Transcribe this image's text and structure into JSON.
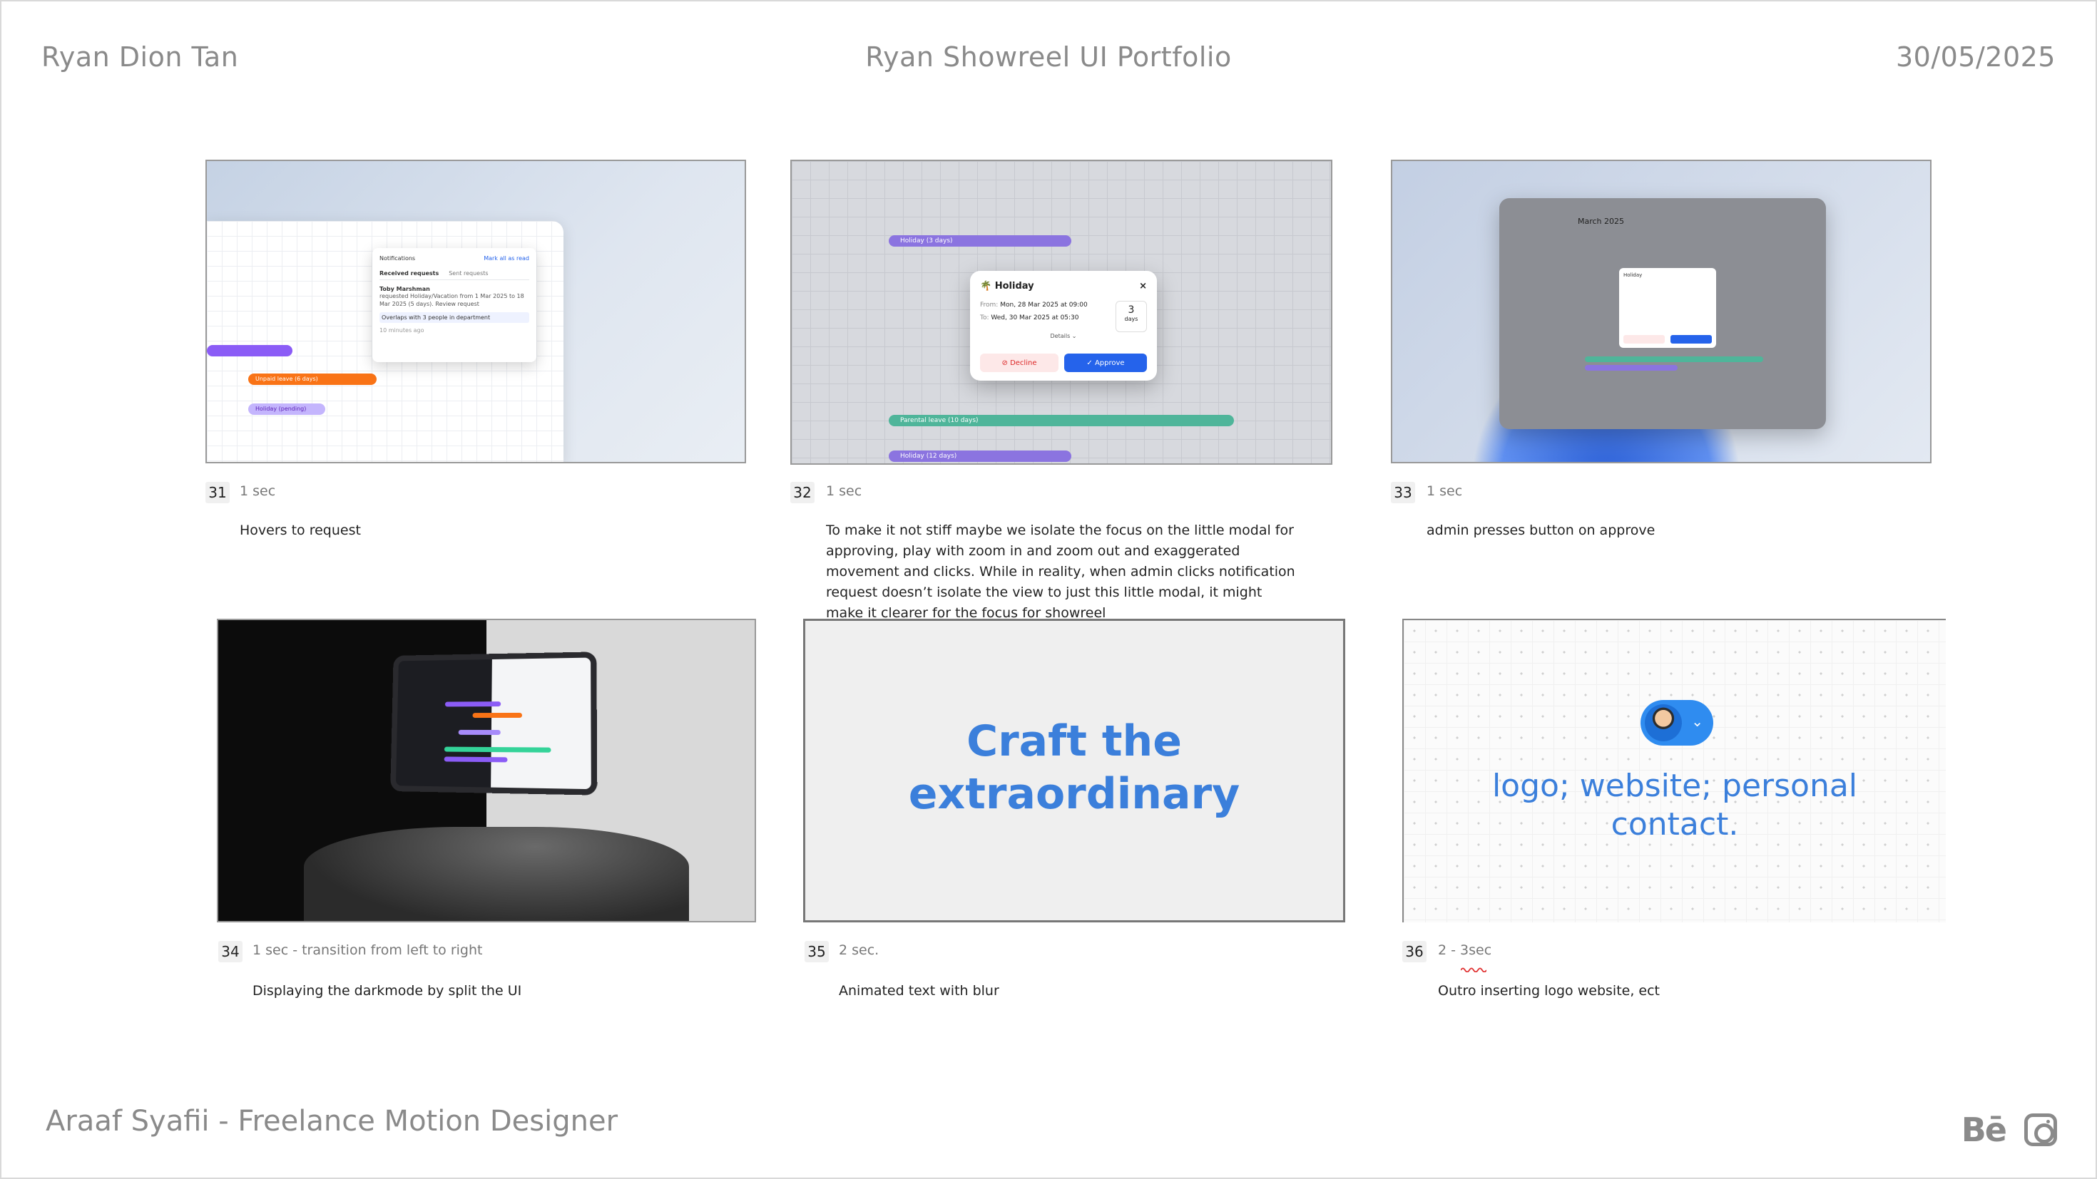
{
  "header": {
    "left": "Ryan Dion Tan",
    "center": "Ryan Showreel UI Portfolio",
    "right": "30/05/2025"
  },
  "footer": {
    "credit": "Araaf Syafii - Freelance Motion Designer",
    "icons": [
      "behance-icon",
      "instagram-icon"
    ],
    "behance_label": "Bē"
  },
  "colors": {
    "accent": "#3b7fdb",
    "muted_text": "#8a8a8a"
  },
  "frames": [
    {
      "num": "31",
      "duration": "1 sec",
      "description": "Hovers to request"
    },
    {
      "num": "32",
      "duration": "1 sec",
      "description": "To make it not stiff maybe we isolate the focus on the little modal for approving, play with zoom in and zoom out and exaggerated movement and clicks.  While in reality, when admin clicks notification request doesn’t isolate the view to just this little modal, it might make it clearer for the focus for showreel"
    },
    {
      "num": "33",
      "duration": "1 sec",
      "description": "admin presses button on approve"
    },
    {
      "num": "34",
      "duration": "1 sec - transition from left to right",
      "description": "Displaying the darkmode by split the UI"
    },
    {
      "num": "35",
      "duration": "2 sec.",
      "description": "Animated text with blur"
    },
    {
      "num": "36",
      "duration": "2 - 3sec",
      "description": "Outro inserting logo website, ect"
    }
  ],
  "shot31": {
    "notifications_title": "Notifications",
    "mark_all": "Mark all as read",
    "tab_received": "Received requests",
    "tab_sent": "Sent requests",
    "requester": "Toby Marshman",
    "request_text": "requested Holiday/Vacation from 1 Mar 2025 to 18 Mar 2025 (5 days). Review request",
    "overlap_text": "Overlaps with 3 people in department",
    "time_ago": "10 minutes ago",
    "bar_orange": "Unpaid leave (6 days)",
    "bar_purple_light": "Holiday (pending)"
  },
  "shot32": {
    "modal_title": "Holiday",
    "from_label": "From:",
    "from_value": "Mon, 28 Mar 2025",
    "from_time": "09:00",
    "to_label": "To:",
    "to_value": "Wed, 30 Mar 2025",
    "to_time": "05:30",
    "days_count": "3",
    "days_label": "days",
    "details": "Details",
    "decline": "Decline",
    "approve": "Approve",
    "bar_purple": "Holiday (3 days)",
    "bar_green": "Parental leave (10 days)",
    "bar_purple_bottom": "Holiday (12 days)"
  },
  "shot33": {
    "calendar_title": "March 2025",
    "modal_title": "Holiday"
  },
  "shot35": {
    "headline_line1": "Craft the",
    "headline_line2": "extraordinary"
  },
  "shot36": {
    "text_line1": "logo; website; personal",
    "text_line2": "contact."
  }
}
